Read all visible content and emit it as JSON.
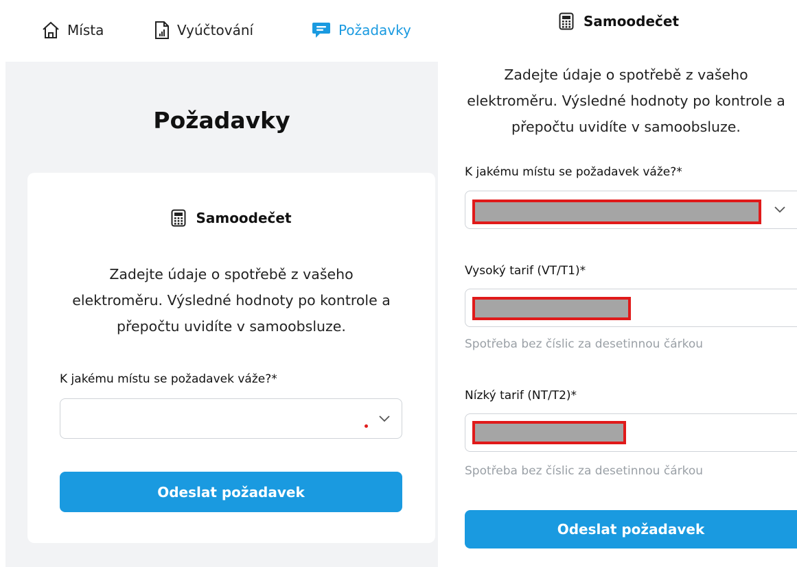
{
  "nav": {
    "items": [
      {
        "label": "Místa",
        "icon": "home-icon",
        "active": false
      },
      {
        "label": "Vyúčtování",
        "icon": "document-chart-icon",
        "active": false
      },
      {
        "label": "Požadavky",
        "icon": "chat-bubble-icon",
        "active": true
      }
    ]
  },
  "left": {
    "page_title": "Požadavky",
    "section_title": "Samoodečet",
    "intro_lines": [
      "Zadejte údaje o spotřebě z vašeho",
      "elektroměru. Výsledné hodnoty po kontrole a",
      "přepočtu uvidíte v samoobsluze."
    ],
    "place_label": "K jakému místu se požadavek váže?*",
    "place_value": "",
    "submit_label": "Odeslat požadavek"
  },
  "right": {
    "section_title": "Samoodečet",
    "intro_lines": [
      "Zadejte údaje o spotřebě z vašeho",
      "elektroměru. Výsledné hodnoty po kontrole a",
      "přepočtu uvidíte v samoobsluze."
    ],
    "place_label": "K jakému místu se požadavek váže?*",
    "high_tariff_label": "Vysoký tarif (VT/T1)*",
    "high_tariff_hint": "Spotřeba bez číslic za desetinnou čárkou",
    "low_tariff_label": "Nízký tarif (NT/T2)*",
    "low_tariff_hint": "Spotřeba bez číslic za desetinnou čárkou",
    "submit_label": "Odeslat požadavek"
  },
  "colors": {
    "accent": "#1a9ae0",
    "redaction_border": "#e01a1a",
    "redaction_fill": "#a5a5a5",
    "panel_background": "#f2f3f5"
  }
}
